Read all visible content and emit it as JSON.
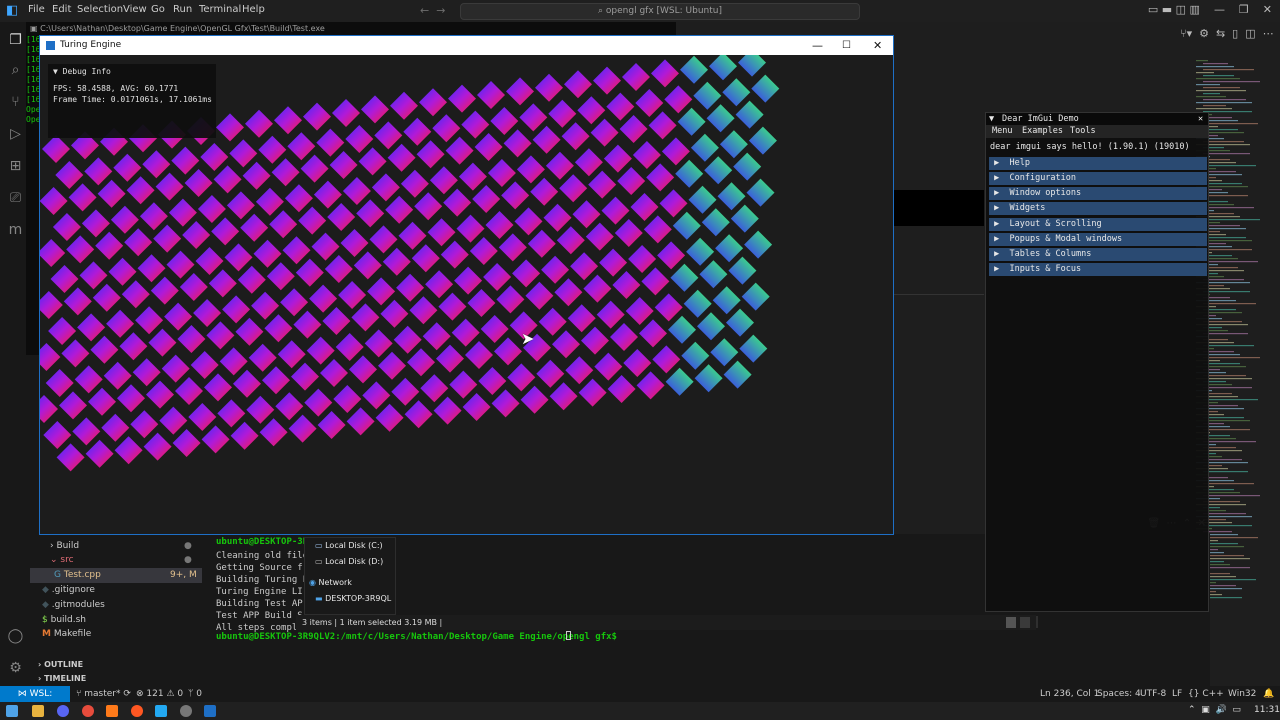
{
  "vscode": {
    "menu": [
      "File",
      "Edit",
      "Selection",
      "View",
      "Go",
      "Run",
      "Terminal",
      "Help"
    ],
    "command_center": "opengl gfx [WSL: Ubuntu]",
    "explorer_items": [
      {
        "label": "Build",
        "kind": "folder",
        "badge": ""
      },
      {
        "label": "src",
        "kind": "folder",
        "badge": ""
      },
      {
        "label": "Test.cpp",
        "kind": "file",
        "badge": "9+, M"
      },
      {
        "label": ".gitignore",
        "kind": "file",
        "badge": ""
      },
      {
        "label": ".gitmodules",
        "kind": "file",
        "badge": ""
      },
      {
        "label": "build.sh",
        "kind": "file",
        "badge": ""
      },
      {
        "label": "Makefile",
        "kind": "file",
        "badge": ""
      }
    ],
    "outline_label": "OUTLINE",
    "timeline_label": "TIMELINE",
    "terminal_lines": [
      {
        "text": "ubuntu@DESKTOP-3R",
        "prompt": true
      },
      {
        "text": "Cleaning old file",
        "prompt": false
      },
      {
        "text": "Getting Source f",
        "prompt": false
      },
      {
        "text": "Building Turing E",
        "prompt": false
      },
      {
        "text": "Turing Engine LI",
        "prompt": false
      },
      {
        "text": "Building Test AP",
        "prompt": false
      },
      {
        "text": "Test APP Build S",
        "prompt": false
      },
      {
        "text": "All steps complet",
        "prompt": false
      },
      {
        "text": "ubuntu@DESKTOP-3R9QLV2:/mnt/c/Users/Nathan/Desktop/Game Engine/opengl gfx$",
        "prompt": true
      }
    ],
    "status": {
      "remote": "WSL: Ubuntu",
      "branch": "master*",
      "problems": "⊗ 121 ⚠ 0",
      "ports": "0",
      "position": "Ln 236, Col 1",
      "spaces": "Spaces: 4",
      "encoding": "UTF-8",
      "eol": "LF",
      "language": "C++",
      "platform": "Win32"
    }
  },
  "background_window_title": "C:\\Users\\Nathan\\Desktop\\Game Engine\\OpenGL Gfx\\Test\\Build\\Test.exe",
  "turing_engine": {
    "title": "Turing Engine",
    "debug_title": "Debug Info",
    "fps_line": "FPS: 58.4588, AVG: 60.1771",
    "frame_time_line": "Frame Time: 0.0171061s, 17.1061ms"
  },
  "imgui_demo": {
    "title": "Dear ImGui Demo",
    "menubar": [
      "Menu",
      "Examples",
      "Tools"
    ],
    "hello": "dear imgui says hello! (1.90.1) (19010)",
    "headers": [
      "Help",
      "Configuration",
      "Window options",
      "Widgets",
      "Layout & Scrolling",
      "Popups & Modal windows",
      "Tables & Columns",
      "Inputs & Focus"
    ]
  },
  "file_explorer": {
    "items": [
      "Local Disk (C:)",
      "Local Disk (D:)",
      "Network",
      "DESKTOP-3R9QL"
    ],
    "status": "3 items  |  1 item selected  3.19 MB  |"
  },
  "clock": "11:31",
  "colors": {
    "accent": "#007acc",
    "pattern_red": "#ff1a3c",
    "pattern_blue": "#3b2bff",
    "pattern_green": "#3bff6a"
  }
}
